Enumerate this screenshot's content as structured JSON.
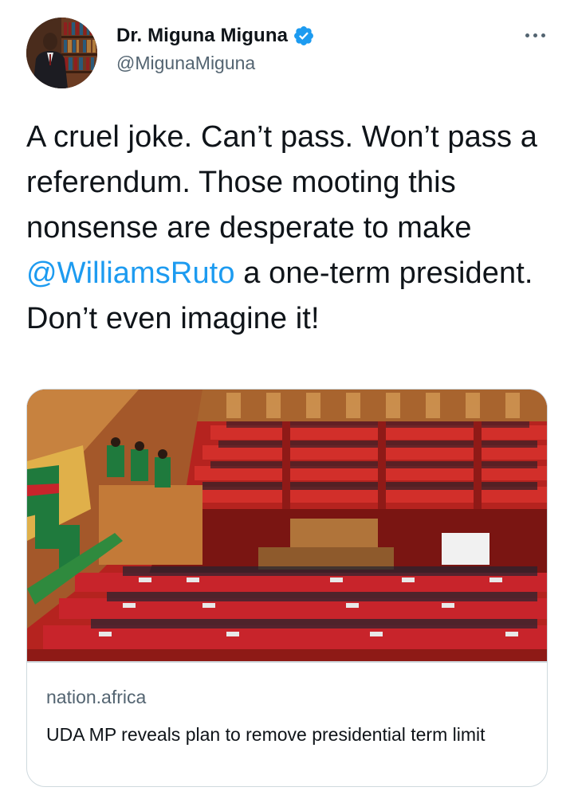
{
  "author": {
    "display_name": "Dr. Miguna Miguna",
    "handle": "@MigunaMiguna",
    "verified": true,
    "avatar_icon": "profile-photo-icon"
  },
  "tweet": {
    "text_before": "A cruel joke. Can’t pass. Won’t pass a referendum. Those mooting this nonsense are desperate to make ",
    "mention": "@WilliamsRuto",
    "text_after": " a one-term president. Don’t even imagine it!"
  },
  "card": {
    "domain": "nation.africa",
    "title": "UDA MP reveals plan to remove presidential term limit"
  },
  "icons": {
    "more": "more-options-icon",
    "verified": "verified-badge-icon"
  },
  "colors": {
    "link": "#1d9bf0",
    "text": "#0f1419",
    "secondary": "#536471",
    "border": "#cfd9de",
    "chamber_red": "#c8242b",
    "chamber_wood": "#a8642e",
    "chamber_green": "#1f7a3d"
  }
}
